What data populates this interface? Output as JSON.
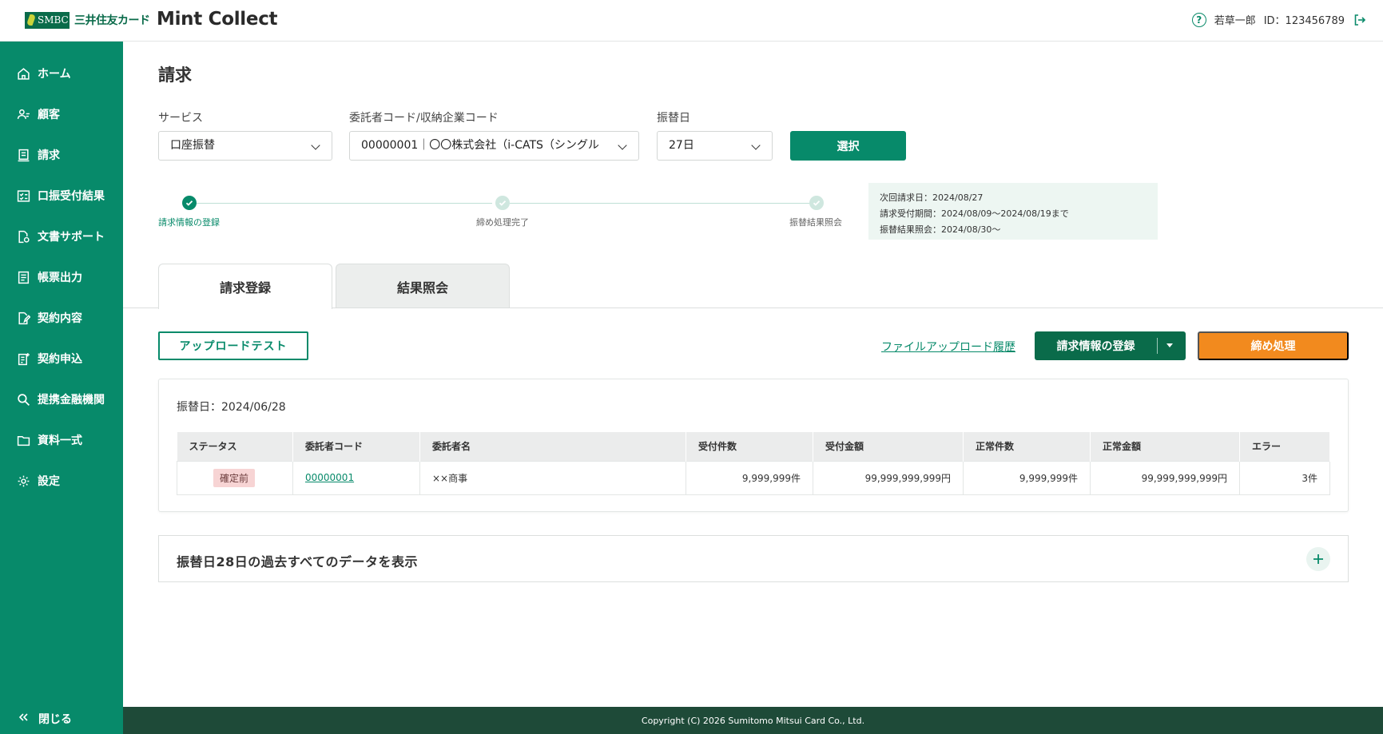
{
  "header": {
    "brand_abbr": "SMBC",
    "brand_name": "三井住友カード",
    "app_name": "Mint Collect",
    "user_name": "若草一郎",
    "user_id": "ID：123456789"
  },
  "sidebar": {
    "items": [
      {
        "label": "ホーム",
        "icon": "home-icon"
      },
      {
        "label": "顧客",
        "icon": "users-icon"
      },
      {
        "label": "請求",
        "icon": "receipt-icon"
      },
      {
        "label": "口振受付結果",
        "icon": "checklist-icon"
      },
      {
        "label": "文書サポート",
        "icon": "document-gear-icon"
      },
      {
        "label": "帳票出力",
        "icon": "report-icon"
      },
      {
        "label": "契約内容",
        "icon": "contract-edit-icon"
      },
      {
        "label": "契約申込",
        "icon": "application-icon"
      },
      {
        "label": "提携金融機関",
        "icon": "search-icon"
      },
      {
        "label": "資料一式",
        "icon": "folder-icon"
      },
      {
        "label": "設定",
        "icon": "gear-icon"
      }
    ],
    "close_label": "閉じる"
  },
  "page": {
    "title": "請求",
    "service_label": "サービス",
    "service_value": "口座振替",
    "consignor_label": "委託者コード/収納企業コード",
    "consignor_value": "00000001｜〇〇株式会社（i-CATS（シングル",
    "transfer_day_label": "振替日",
    "transfer_day_value": "27日",
    "select_button": "選択"
  },
  "stepper": {
    "steps": [
      "請求情報の登録",
      "締め処理完了",
      "振替結果照会"
    ]
  },
  "info": {
    "line1": "次回請求日：2024/08/27",
    "line2": "請求受付期間：2024/08/09〜2024/08/19まで",
    "line3": "振替結果照会：2024/08/30〜"
  },
  "tabs": [
    "請求登録",
    "結果照会"
  ],
  "actions": {
    "upload_test": "アップロードテスト",
    "upload_history": "ファイルアップロード履歴",
    "register": "請求情報の登録",
    "close_process": "締め処理"
  },
  "card": {
    "date_label": "振替日：2024/06/28",
    "columns": [
      "ステータス",
      "委託者コード",
      "委託者名",
      "受付件数",
      "受付金額",
      "正常件数",
      "正常金額",
      "エラー"
    ],
    "row": {
      "status": "確定前",
      "code": "00000001",
      "name": "××商事",
      "received_count": "9,999,999件",
      "received_amount": "99,999,999,999円",
      "normal_count": "9,999,999件",
      "normal_amount": "99,999,999,999円",
      "errors": "3件"
    }
  },
  "accordion": {
    "title": "振替日28日の過去すべてのデータを表示"
  },
  "footer": {
    "copyright": "Copyright (C) 2026 Sumitomo Mitsui Card Co., Ltd."
  },
  "colors": {
    "primary": "#078a6a",
    "dark_green": "#0a6b4a",
    "orange": "#f28a1e",
    "footer": "#1e4a38"
  }
}
